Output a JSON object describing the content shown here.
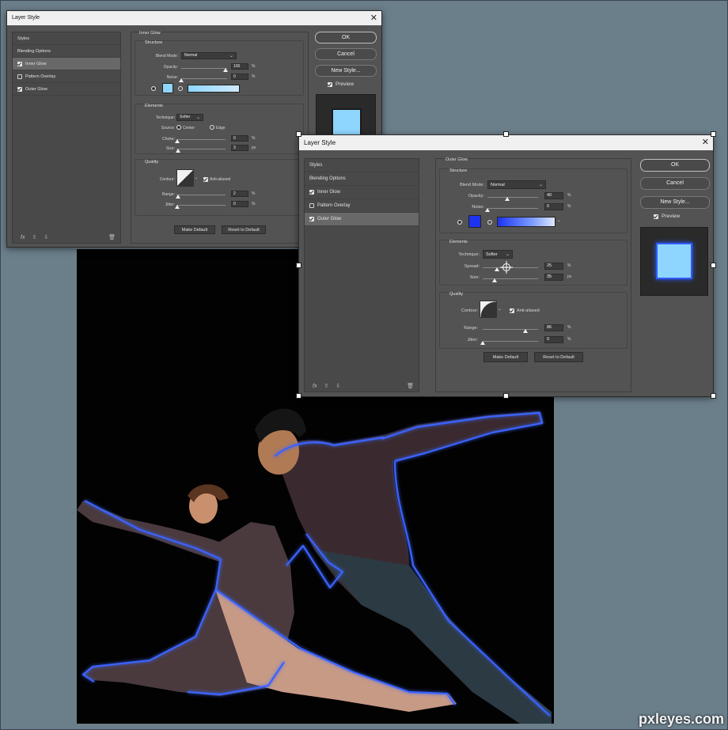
{
  "watermark": "pxleyes.com",
  "dialog_back": {
    "title": "Layer Style",
    "styles_list": [
      {
        "label": "Styles",
        "checkbox": "none"
      },
      {
        "label": "Blending Options",
        "checkbox": "none"
      },
      {
        "label": "Inner Glow",
        "checkbox": "checked",
        "selected": true
      },
      {
        "label": "Pattern Overlay",
        "checkbox": "empty"
      },
      {
        "label": "Outer Glow",
        "checkbox": "checked"
      }
    ],
    "section_title": "Inner Glow",
    "structure": {
      "title": "Structure",
      "blend_mode_label": "Blend Mode:",
      "blend_mode_value": "Normal",
      "opacity_label": "Opacity:",
      "opacity_value": "100",
      "noise_label": "Noise:",
      "noise_value": "0",
      "percent": "%",
      "swatch_color": "#8fd6ff"
    },
    "elements": {
      "title": "Elements",
      "technique_label": "Technique:",
      "technique_value": "Softer",
      "source_label": "Source:",
      "source_center": "Center",
      "source_edge": "Edge",
      "choke_label": "Choke:",
      "choke_value": "0",
      "size_label": "Size:",
      "size_value": "3",
      "px": "px"
    },
    "quality": {
      "title": "Quality",
      "contour_label": "Contour:",
      "anti_aliased": "Anti-aliased",
      "range_label": "Range:",
      "range_value": "2",
      "jitter_label": "Jitter:",
      "jitter_value": "0"
    },
    "make_default": "Make Default",
    "reset_default": "Reset to Default",
    "ok": "OK",
    "cancel": "Cancel",
    "new_style": "New Style...",
    "preview": "Preview",
    "preview_color": "#8fd6ff"
  },
  "dialog_front": {
    "title": "Layer Style",
    "styles_list": [
      {
        "label": "Styles",
        "checkbox": "none"
      },
      {
        "label": "Blending Options",
        "checkbox": "none"
      },
      {
        "label": "Inner Glow",
        "checkbox": "checked"
      },
      {
        "label": "Pattern Overlay",
        "checkbox": "empty"
      },
      {
        "label": "Outer Glow",
        "checkbox": "checked",
        "selected": true
      }
    ],
    "section_title": "Outer Glow",
    "structure": {
      "title": "Structure",
      "blend_mode_label": "Blend Mode:",
      "blend_mode_value": "Normal",
      "opacity_label": "Opacity:",
      "opacity_value": "40",
      "noise_label": "Noise:",
      "noise_value": "0",
      "percent": "%",
      "swatch_color": "#1c34f0"
    },
    "elements": {
      "title": "Elements",
      "technique_label": "Technique:",
      "technique_value": "Softer",
      "spread_label": "Spread:",
      "spread_value": "25",
      "size_label": "Size:",
      "size_value": "35",
      "px": "px"
    },
    "quality": {
      "title": "Quality",
      "contour_label": "Contour:",
      "anti_aliased": "Anti-aliased",
      "range_label": "Range:",
      "range_value": "86",
      "jitter_label": "Jitter:",
      "jitter_value": "0"
    },
    "make_default": "Make Default",
    "reset_default": "Reset to Default",
    "ok": "OK",
    "cancel": "Cancel",
    "new_style": "New Style...",
    "preview": "Preview",
    "preview_color": "#8fd6ff"
  },
  "colors": {
    "app_background": "#6b7f8b",
    "dialog_background": "#535353",
    "glow_blue": "#3a64ff"
  }
}
